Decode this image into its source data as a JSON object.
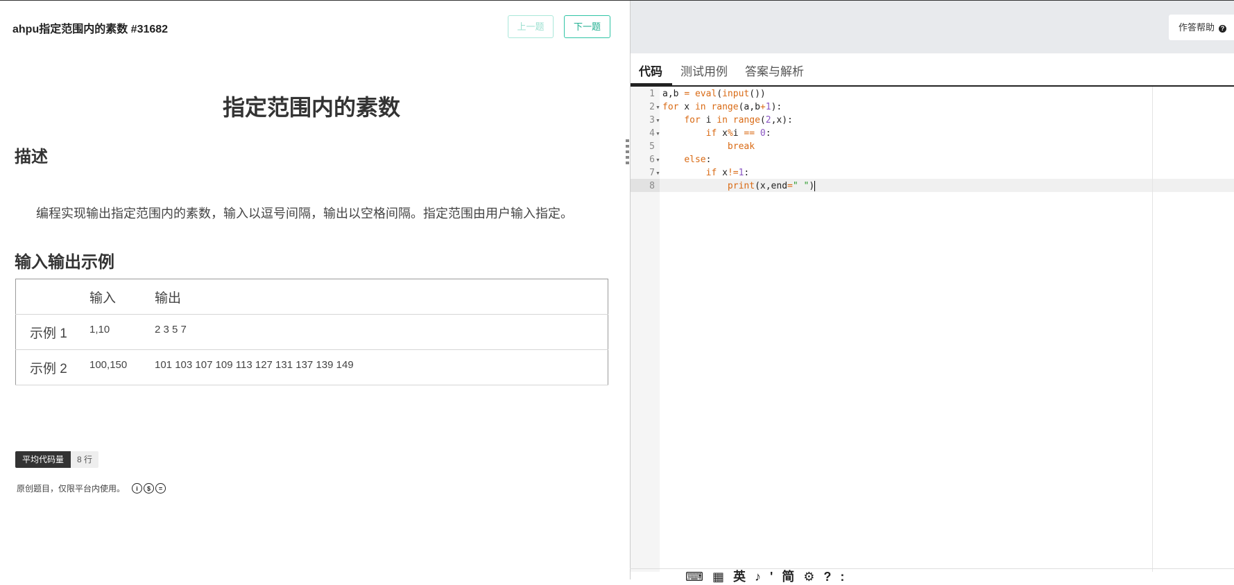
{
  "question": {
    "id_label": "ahpu指定范围内的素数 #31682",
    "prev_label": "上一题",
    "next_label": "下一题",
    "title": "指定范围内的素数",
    "desc_heading": "描述",
    "description": "编程实现输出指定范围内的素数，输入以逗号间隔，输出以空格间隔。指定范围由用户输入指定。",
    "examples_heading": "输入输出示例",
    "table": {
      "headers": [
        "",
        "输入",
        "输出"
      ],
      "rows": [
        {
          "label": "示例 1",
          "input": "1,10",
          "output": "2 3 5 7"
        },
        {
          "label": "示例 2",
          "input": "100,150",
          "output": "101 103 107 109 113 127 131 137 139 149"
        }
      ]
    },
    "avg_code_label": "平均代码量",
    "avg_code_value": "8 行",
    "license_text": "原创题目，仅限平台内使用。"
  },
  "editor": {
    "help_label": "作答帮助",
    "tabs": [
      "代码",
      "测试用例",
      "答案与解析"
    ],
    "active_tab": 0,
    "line_numbers": [
      "1",
      "2",
      "3",
      "4",
      "5",
      "6",
      "7",
      "8"
    ],
    "code": [
      "a,b = eval(input())",
      "for x in range(a,b+1):",
      "    for i in range(2,x):",
      "        if x%i == 0:",
      "            break",
      "    else:",
      "        if x!=1:",
      "            print(x,end=\" \")"
    ],
    "active_line": 8,
    "ime_glyphs": "⌨ ▦ 英 ♪ ' 简 ⚙ ? :"
  },
  "colors": {
    "accent": "#2ec4a5",
    "keyword": "#d96a14",
    "number": "#8a56c2",
    "string": "#2b9a2b"
  }
}
